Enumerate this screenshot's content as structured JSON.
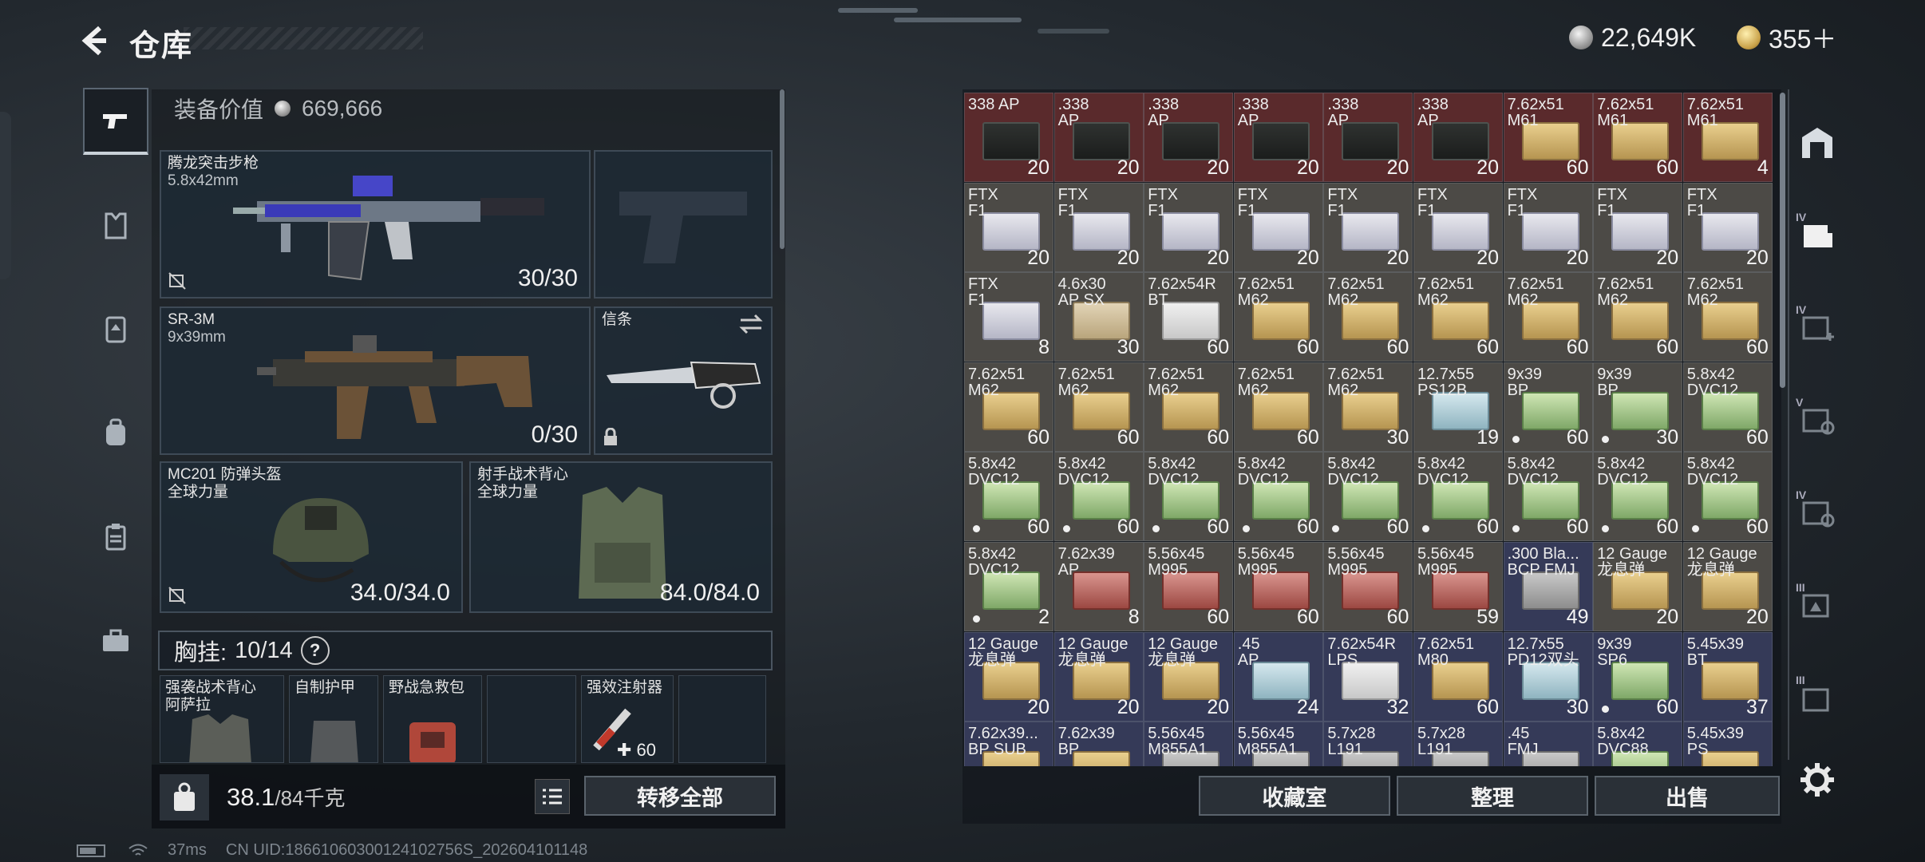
{
  "header": {
    "title": "仓库",
    "currency_silver": "22,649K",
    "currency_gold": "355＋"
  },
  "equipment": {
    "value_label": "装备价值",
    "value": "669,666",
    "primary": {
      "name": "腾龙突击步枪",
      "caliber": "5.8x42mm",
      "ammo": "30/30"
    },
    "secondary": {
      "name": "SR-3M",
      "caliber": "9x39mm",
      "ammo": "0/30"
    },
    "melee": {
      "name": "信条"
    },
    "helmet": {
      "name": "MC201 防弹头盔",
      "brand": "全球力量",
      "durability": "34.0/34.0"
    },
    "vest": {
      "name": "射手战术背心",
      "brand": "全球力量",
      "durability": "84.0/84.0"
    },
    "rig": {
      "label": "胸挂:",
      "capacity": "10/14",
      "help": "?",
      "items": [
        {
          "name": "强袭战术背心\n阿萨拉"
        },
        {
          "name": "自制护甲"
        },
        {
          "name": "野战急救包"
        },
        {
          "name": ""
        },
        {
          "name": "强效注射器",
          "count": "60"
        },
        {
          "name": ""
        }
      ]
    },
    "weight_value": "38.1",
    "weight_unit": "/84千克",
    "transfer_all": "转移全部"
  },
  "storage": {
    "cells": [
      [
        "338 AP",
        "20",
        "red",
        "ammo-can",
        false
      ],
      [
        ".338\nAP",
        "20",
        "red",
        "ammo-can",
        false
      ],
      [
        ".338\nAP",
        "20",
        "red",
        "ammo-can",
        false
      ],
      [
        ".338\nAP",
        "20",
        "red",
        "ammo-can",
        false
      ],
      [
        ".338\nAP",
        "20",
        "red",
        "ammo-can",
        false
      ],
      [
        ".338\nAP",
        "20",
        "red",
        "ammo-can",
        false
      ],
      [
        "7.62x51\nM61",
        "60",
        "red",
        "yellow",
        false
      ],
      [
        "7.62x51\nM61",
        "60",
        "red",
        "yellow",
        false
      ],
      [
        "7.62x51\nM61",
        "4",
        "red",
        "yellow",
        false
      ],
      [
        "FTX\nF1",
        "20",
        "grey",
        "ftx",
        false
      ],
      [
        "FTX\nF1",
        "20",
        "grey",
        "ftx",
        false
      ],
      [
        "FTX\nF1",
        "20",
        "grey",
        "ftx",
        false
      ],
      [
        "FTX\nF1",
        "20",
        "grey",
        "ftx",
        false
      ],
      [
        "FTX\nF1",
        "20",
        "grey",
        "ftx",
        false
      ],
      [
        "FTX\nF1",
        "20",
        "grey",
        "ftx",
        false
      ],
      [
        "FTX\nF1",
        "20",
        "grey",
        "ftx",
        false
      ],
      [
        "FTX\nF1",
        "20",
        "grey",
        "ftx",
        false
      ],
      [
        "FTX\nF1",
        "20",
        "grey",
        "ftx",
        false
      ],
      [
        "FTX\nF1",
        "8",
        "grey",
        "ftx",
        false
      ],
      [
        "4.6x30\nAP SX",
        "30",
        "grey",
        "tan",
        false
      ],
      [
        "7.62x54R\nBT",
        "60",
        "grey",
        "white",
        false
      ],
      [
        "7.62x51\nM62",
        "60",
        "grey",
        "yellow",
        false
      ],
      [
        "7.62x51\nM62",
        "60",
        "grey",
        "yellow",
        false
      ],
      [
        "7.62x51\nM62",
        "60",
        "grey",
        "yellow",
        false
      ],
      [
        "7.62x51\nM62",
        "60",
        "grey",
        "yellow",
        false
      ],
      [
        "7.62x51\nM62",
        "60",
        "grey",
        "yellow",
        false
      ],
      [
        "7.62x51\nM62",
        "60",
        "grey",
        "yellow",
        false
      ],
      [
        "7.62x51\nM62",
        "60",
        "grey",
        "yellow",
        false
      ],
      [
        "7.62x51\nM62",
        "60",
        "grey",
        "yellow",
        false
      ],
      [
        "7.62x51\nM62",
        "60",
        "grey",
        "yellow",
        false
      ],
      [
        "7.62x51\nM62",
        "60",
        "grey",
        "yellow",
        false
      ],
      [
        "7.62x51\nM62",
        "30",
        "grey",
        "yellow",
        false
      ],
      [
        "12.7x55\nPS12B",
        "19",
        "grey",
        "teal",
        false
      ],
      [
        "9x39\nBP",
        "60",
        "grey",
        "green",
        true
      ],
      [
        "9x39\nBP",
        "30",
        "grey",
        "green",
        true
      ],
      [
        "5.8x42\nDVC12",
        "60",
        "grey",
        "green",
        false
      ],
      [
        "5.8x42\nDVC12",
        "60",
        "grey",
        "green",
        true
      ],
      [
        "5.8x42\nDVC12",
        "60",
        "grey",
        "green",
        true
      ],
      [
        "5.8x42\nDVC12",
        "60",
        "grey",
        "green",
        true
      ],
      [
        "5.8x42\nDVC12",
        "60",
        "grey",
        "green",
        true
      ],
      [
        "5.8x42\nDVC12",
        "60",
        "grey",
        "green",
        true
      ],
      [
        "5.8x42\nDVC12",
        "60",
        "grey",
        "green",
        true
      ],
      [
        "5.8x42\nDVC12",
        "60",
        "grey",
        "green",
        true
      ],
      [
        "5.8x42\nDVC12",
        "60",
        "grey",
        "green",
        true
      ],
      [
        "5.8x42\nDVC12",
        "60",
        "grey",
        "green",
        true
      ],
      [
        "5.8x42\nDVC12",
        "2",
        "grey",
        "green",
        true
      ],
      [
        "7.62x39\nAP",
        "8",
        "grey",
        "red",
        false
      ],
      [
        "5.56x45\nM995",
        "60",
        "grey",
        "red",
        false
      ],
      [
        "5.56x45\nM995",
        "60",
        "grey",
        "red",
        false
      ],
      [
        "5.56x45\nM995",
        "60",
        "grey",
        "red",
        false
      ],
      [
        "5.56x45\nM995",
        "59",
        "grey",
        "red",
        false
      ],
      [
        ".300 Bla...\nBCP FMJ",
        "49",
        "blue",
        "grey",
        false
      ],
      [
        "12 Gauge\n龙息弹",
        "20",
        "grey",
        "yellow",
        false
      ],
      [
        "12 Gauge\n龙息弹",
        "20",
        "grey",
        "yellow",
        false
      ],
      [
        "12 Gauge\n龙息弹",
        "20",
        "blue",
        "yellow",
        false
      ],
      [
        "12 Gauge\n龙息弹",
        "20",
        "blue",
        "yellow",
        false
      ],
      [
        "12 Gauge\n龙息弹",
        "20",
        "blue",
        "yellow",
        false
      ],
      [
        ".45\nAP",
        "24",
        "blue",
        "teal",
        false
      ],
      [
        "7.62x54R\nLPS",
        "32",
        "blue",
        "white",
        false
      ],
      [
        "7.62x51\nM80",
        "60",
        "blue",
        "yellow",
        false
      ],
      [
        "12.7x55\nPD12双头",
        "30",
        "blue",
        "teal",
        false
      ],
      [
        "9x39\nSP6",
        "60",
        "blue",
        "green",
        true
      ],
      [
        "5.45x39\nBT",
        "37",
        "blue",
        "yellow",
        false
      ],
      [
        "7.62x39...\nBP SUB",
        "",
        "blue",
        "yellow",
        false
      ],
      [
        "7.62x39\nBP",
        "",
        "blue",
        "yellow",
        false
      ],
      [
        "5.56x45\nM855A1",
        "",
        "blue",
        "grey",
        false
      ],
      [
        "5.56x45\nM855A1",
        "",
        "blue",
        "grey",
        false
      ],
      [
        "5.7x28\nL191",
        "",
        "blue",
        "grey",
        false
      ],
      [
        "5.7x28\nL191",
        "",
        "blue",
        "grey",
        false
      ],
      [
        ".45\nFMJ",
        "",
        "blue",
        "grey",
        false
      ],
      [
        "5.8x42\nDVC88",
        "",
        "blue",
        "green",
        false
      ],
      [
        "5.45x39\nPS",
        "",
        "blue",
        "yellow",
        false
      ]
    ],
    "buttons": {
      "vault": "收藏室",
      "sort": "整理",
      "sell": "出售"
    }
  },
  "status": {
    "ping": "37ms",
    "uid": "CN UID:18661060300124102756S_202604101148"
  }
}
